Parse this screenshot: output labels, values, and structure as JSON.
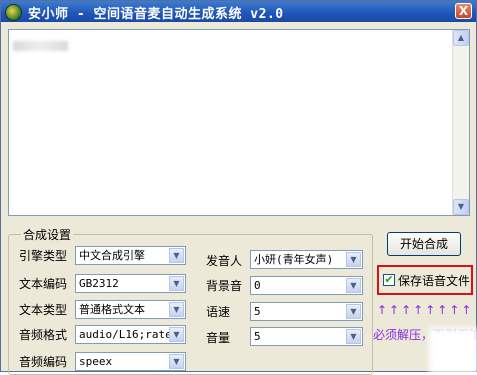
{
  "window": {
    "title": "安小师 - 空间语音麦自动生成系统 v2.0",
    "close_glyph": "X"
  },
  "textarea": {
    "content": ""
  },
  "settings": {
    "group_title": "合成设置",
    "left": [
      {
        "label": "引擎类型",
        "value": "中文合成引擎"
      },
      {
        "label": "文本编码",
        "value": "GB2312"
      },
      {
        "label": "文本类型",
        "value": "普通格式文本"
      },
      {
        "label": "音频格式",
        "value": "audio/L16;rate="
      },
      {
        "label": "音频编码",
        "value": "speex"
      }
    ],
    "right": [
      {
        "label": "发音人",
        "value": "小妍(青年女声)"
      },
      {
        "label": "背景音",
        "value": "0"
      },
      {
        "label": "语速",
        "value": "5"
      },
      {
        "label": "音量",
        "value": "5"
      }
    ]
  },
  "actions": {
    "start_label": "开始合成",
    "save_label": "保存语音文件",
    "save_checked": true,
    "arrows": "↑↑↑↑↑↑↑↑",
    "warning": "必须解压，否则无法"
  },
  "colors": {
    "highlight_border": "#e01010",
    "warning_text": "#8a2be2"
  }
}
